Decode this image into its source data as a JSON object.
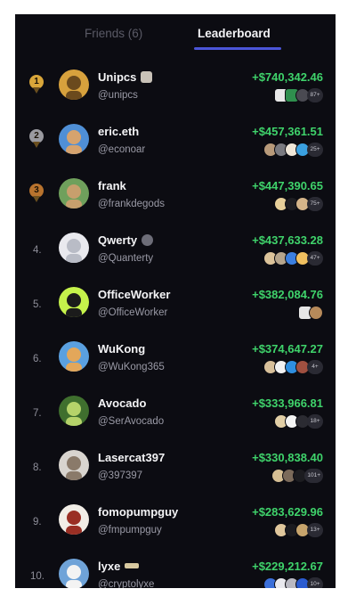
{
  "tabs": {
    "friends": "Friends (6)",
    "leaderboard": "Leaderboard"
  },
  "colors": {
    "accent": "#4b55d8",
    "profit": "#3fd36b",
    "gold": "#d9a63a",
    "silver": "#9a9aa0",
    "bronze": "#b8732e"
  },
  "leaderboard": [
    {
      "rank": "1",
      "medal": "gold",
      "name": "Unipcs",
      "badge": "pug-emoji",
      "handle": "@unipcs",
      "pnl": "+$740,342.46",
      "avatar": [
        "#d7a13d",
        "#6b4a1d"
      ],
      "chips": [
        "#e8e8e8|sq",
        "#2f8f4e|sq",
        "#4a4a52"
      ],
      "more": "87+"
    },
    {
      "rank": "2",
      "medal": "silver",
      "name": "eric.eth",
      "badge": "",
      "handle": "@econoar",
      "pnl": "+$457,361.51",
      "avatar": [
        "#4f8fd6",
        "#d6a36e"
      ],
      "chips": [
        "#b89a7a",
        "#7a7a80",
        "#f0e7d8",
        "#3aa0e0"
      ],
      "more": "25+"
    },
    {
      "rank": "3",
      "medal": "bronze",
      "name": "frank",
      "badge": "",
      "handle": "@frankdegods",
      "pnl": "+$447,390.65",
      "avatar": [
        "#6fa05c",
        "#c79f6d"
      ],
      "chips": [
        "#e7cf9a",
        "#1d1d22",
        "#d4b48a"
      ],
      "more": "75+"
    },
    {
      "rank": "4.",
      "medal": "",
      "name": "Qwerty",
      "badge": "round",
      "handle": "@Quanterty",
      "pnl": "+$437,633.28",
      "avatar": [
        "#e9e9ee",
        "#b9bcc6"
      ],
      "chips": [
        "#dcc39a",
        "#b6a58c",
        "#3b7fe0",
        "#f0c060"
      ],
      "more": "47+"
    },
    {
      "rank": "5.",
      "medal": "",
      "name": "OfficeWorker",
      "badge": "",
      "handle": "@OfficeWorker",
      "pnl": "+$382,084.76",
      "avatar": [
        "#c5f24b",
        "#1b1b1b"
      ],
      "chips": [
        "#e6e6e6|sq",
        "#b78a5a"
      ],
      "more": ""
    },
    {
      "rank": "6.",
      "medal": "",
      "name": "WuKong",
      "badge": "",
      "handle": "@WuKong365",
      "pnl": "+$374,647.27",
      "avatar": [
        "#5aa0e0",
        "#e3a75a"
      ],
      "chips": [
        "#d8c09a",
        "#f2f2f2",
        "#2f8fe0",
        "#a05040"
      ],
      "more": "4+"
    },
    {
      "rank": "7.",
      "medal": "",
      "name": "Avocado",
      "badge": "",
      "handle": "@SerAvocado",
      "pnl": "+$333,966.81",
      "avatar": [
        "#3f6f2e",
        "#b6d36a"
      ],
      "chips": [
        "#e2cfa6",
        "#f4f4f4",
        "#2b2b32"
      ],
      "more": "18+"
    },
    {
      "rank": "8.",
      "medal": "",
      "name": "Lasercat397",
      "badge": "",
      "handle": "@397397",
      "pnl": "+$330,838.40",
      "avatar": [
        "#d8d4cf",
        "#8a7a6a"
      ],
      "chips": [
        "#d6bf94",
        "#7b6a5a",
        "#1c1c20"
      ],
      "more": "101+"
    },
    {
      "rank": "9.",
      "medal": "",
      "name": "fomopumpguy",
      "badge": "",
      "handle": "@fmpumpguy",
      "pnl": "+$283,629.96",
      "avatar": [
        "#f1ede6",
        "#9a2f24"
      ],
      "chips": [
        "#e0c79c",
        "#1b1b20",
        "#c7a46c"
      ],
      "more": "13+"
    },
    {
      "rank": "10.",
      "medal": "",
      "name": "lyxe",
      "badge": "wing",
      "handle": "@cryptolyxe",
      "pnl": "+$229,212.67",
      "avatar": [
        "#6fa3d8",
        "#f3f3f3"
      ],
      "chips": [
        "#3b6fd9",
        "#e9e9ee",
        "#b9b9c2",
        "#2a5bd0"
      ],
      "more": "10+"
    }
  ]
}
